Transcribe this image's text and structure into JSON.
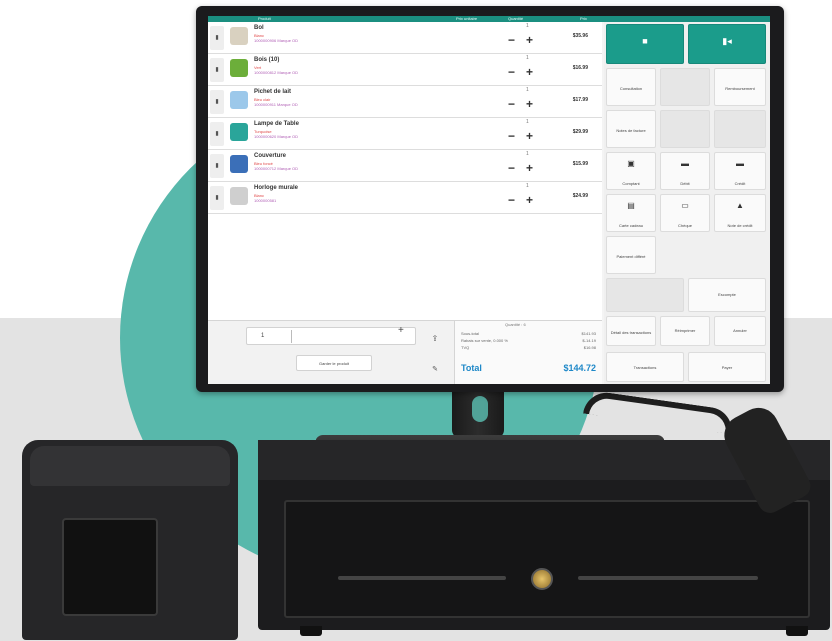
{
  "colors": {
    "accent": "#1b9c8b",
    "header": "#1b8f80",
    "total": "#1e88c8",
    "backdrop_circle": "#58b8ab"
  },
  "header": {
    "col_product": "Produit",
    "col_price": "Prix unitaire",
    "col_qty": "Quantité",
    "col_total": "Prix"
  },
  "items": [
    {
      "name": "Bol",
      "line1": "Blanc",
      "sku": "1000000906 Marque OD",
      "qty": "1",
      "price": "$35.96",
      "thumb_color": "#d9d1c0"
    },
    {
      "name": "Bois (10)",
      "line1": "Vert",
      "sku": "1000000812 Marque OD",
      "qty": "1",
      "price": "$16.99",
      "thumb_color": "#6cae3a"
    },
    {
      "name": "Pichet de lait",
      "line1": "Bleu clair",
      "sku": "1000000911 Marque OD",
      "qty": "1",
      "price": "$17.99",
      "thumb_color": "#9cc8ea"
    },
    {
      "name": "Lampe de Table",
      "line1": "Turquoise",
      "sku": "1000000620 Marque OD",
      "qty": "1",
      "price": "$29.99",
      "thumb_color": "#2aa59a"
    },
    {
      "name": "Couverture",
      "line1": "Bleu foncé",
      "sku": "1000000712 Marque OD",
      "qty": "1",
      "price": "$15.99",
      "thumb_color": "#3b6fb8"
    },
    {
      "name": "Horloge murale",
      "line1": "Blanc",
      "sku": "1000000581",
      "qty": "1",
      "price": "$24.99",
      "thumb_color": "#cfcfcf"
    }
  ],
  "entry": {
    "qty": "1",
    "add": "+",
    "button": "Garder le produit"
  },
  "icons": {
    "remove": "trash-icon",
    "upload": "upload-icon",
    "edit": "pencil-icon"
  },
  "totals": {
    "items_label": "Quantité : 6",
    "rows": [
      {
        "label": "Sous-total",
        "value": "$141.93"
      },
      {
        "label": "Rabais sur vente, 0.000 %",
        "value": "$-14.19"
      },
      {
        "label": "TVQ",
        "value": "$16.98"
      }
    ],
    "total_label": "Total",
    "total_value": "$144.72"
  },
  "actions": {
    "customer": "Consultation",
    "refunds": "Remboursement",
    "note": "Notes de facture",
    "cash": "Comptant",
    "debit": "Débit",
    "credit": "Crédit",
    "gift_card": "Carte cadeau",
    "cheque": "Chèque",
    "store_credit": "Note de crédit",
    "payment_terms": "Paiement différé",
    "discount": "Escompte",
    "transactions_detail": "Détail des transactions",
    "reprint": "Réimprimer",
    "delete": "Annuler",
    "transactions": "Transactions",
    "pay": "Payer"
  }
}
